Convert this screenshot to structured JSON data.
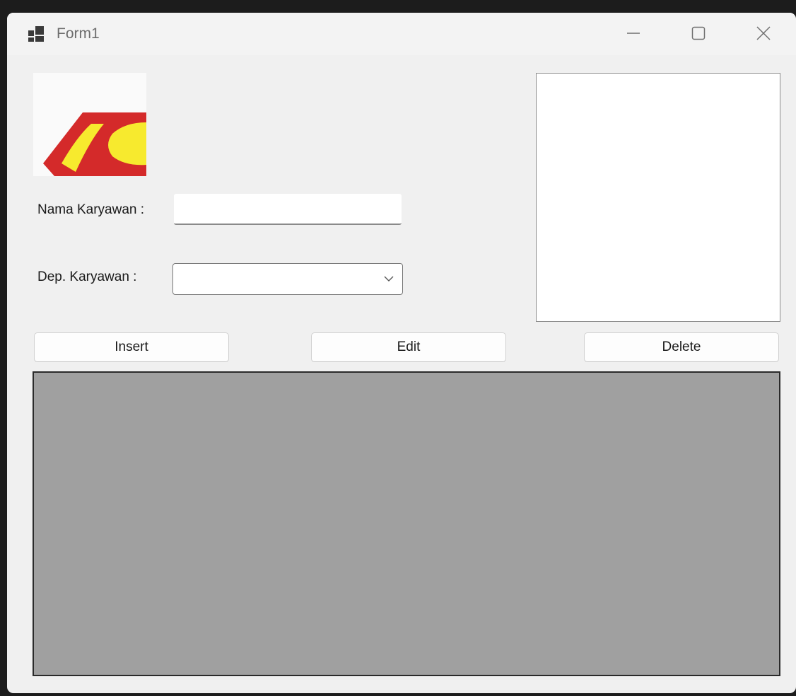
{
  "window": {
    "title": "Form1",
    "controls": {
      "minimize": "minimize-icon",
      "maximize": "maximize-icon",
      "close": "close-icon"
    }
  },
  "form": {
    "nama_label": "Nama Karyawan :",
    "nama_value": "",
    "dep_label": "Dep. Karyawan :",
    "dep_value": ""
  },
  "buttons": {
    "insert": "Insert",
    "edit": "Edit",
    "delete": "Delete"
  },
  "colors": {
    "logo_red": "#d42a2a",
    "logo_yellow": "#f7ea2e",
    "grid_background": "#a0a0a0",
    "form_background": "#f0f0f0"
  }
}
